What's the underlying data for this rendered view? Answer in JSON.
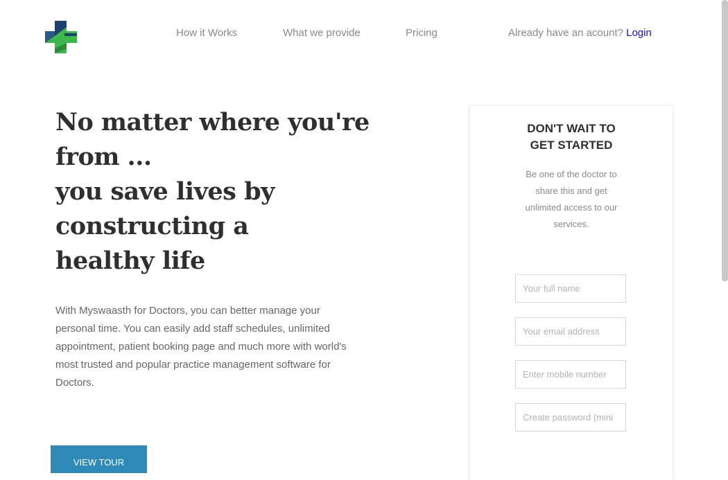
{
  "header": {
    "logo_icon": "medical-cross-logo",
    "nav": [
      "How it Works",
      "What we provide",
      "Pricing"
    ],
    "account_prompt": "Already have an acount?",
    "login_label": "Login"
  },
  "hero": {
    "headline_lines": [
      "No matter where you're",
      "from ...",
      "you save lives by",
      "constructing a",
      "healthy life"
    ],
    "intro": "With Myswaasth for Doctors, you can better manage your personal time. You can easily add staff schedules, unlimited appointment, patient booking page and much more with world's most trusted and popular practice management software for Doctors.",
    "view_tour_label": "VIEW TOUR"
  },
  "signup": {
    "title_lines": [
      "DON'T WAIT TO",
      "GET STARTED"
    ],
    "description": "Be one of the doctor to share this and get unlimited access to our services.",
    "fields": [
      {
        "placeholder": "Your full name",
        "value": ""
      },
      {
        "placeholder": "Your email address",
        "value": ""
      },
      {
        "placeholder": "Enter mobile number",
        "value": ""
      },
      {
        "placeholder": "Create password (mini",
        "value": ""
      }
    ]
  },
  "colors": {
    "brand_green": "#3cb94a",
    "brand_navy": "#1f3f6e",
    "link_blue": "#1a0dcc",
    "button_blue": "#2e8bb8"
  }
}
